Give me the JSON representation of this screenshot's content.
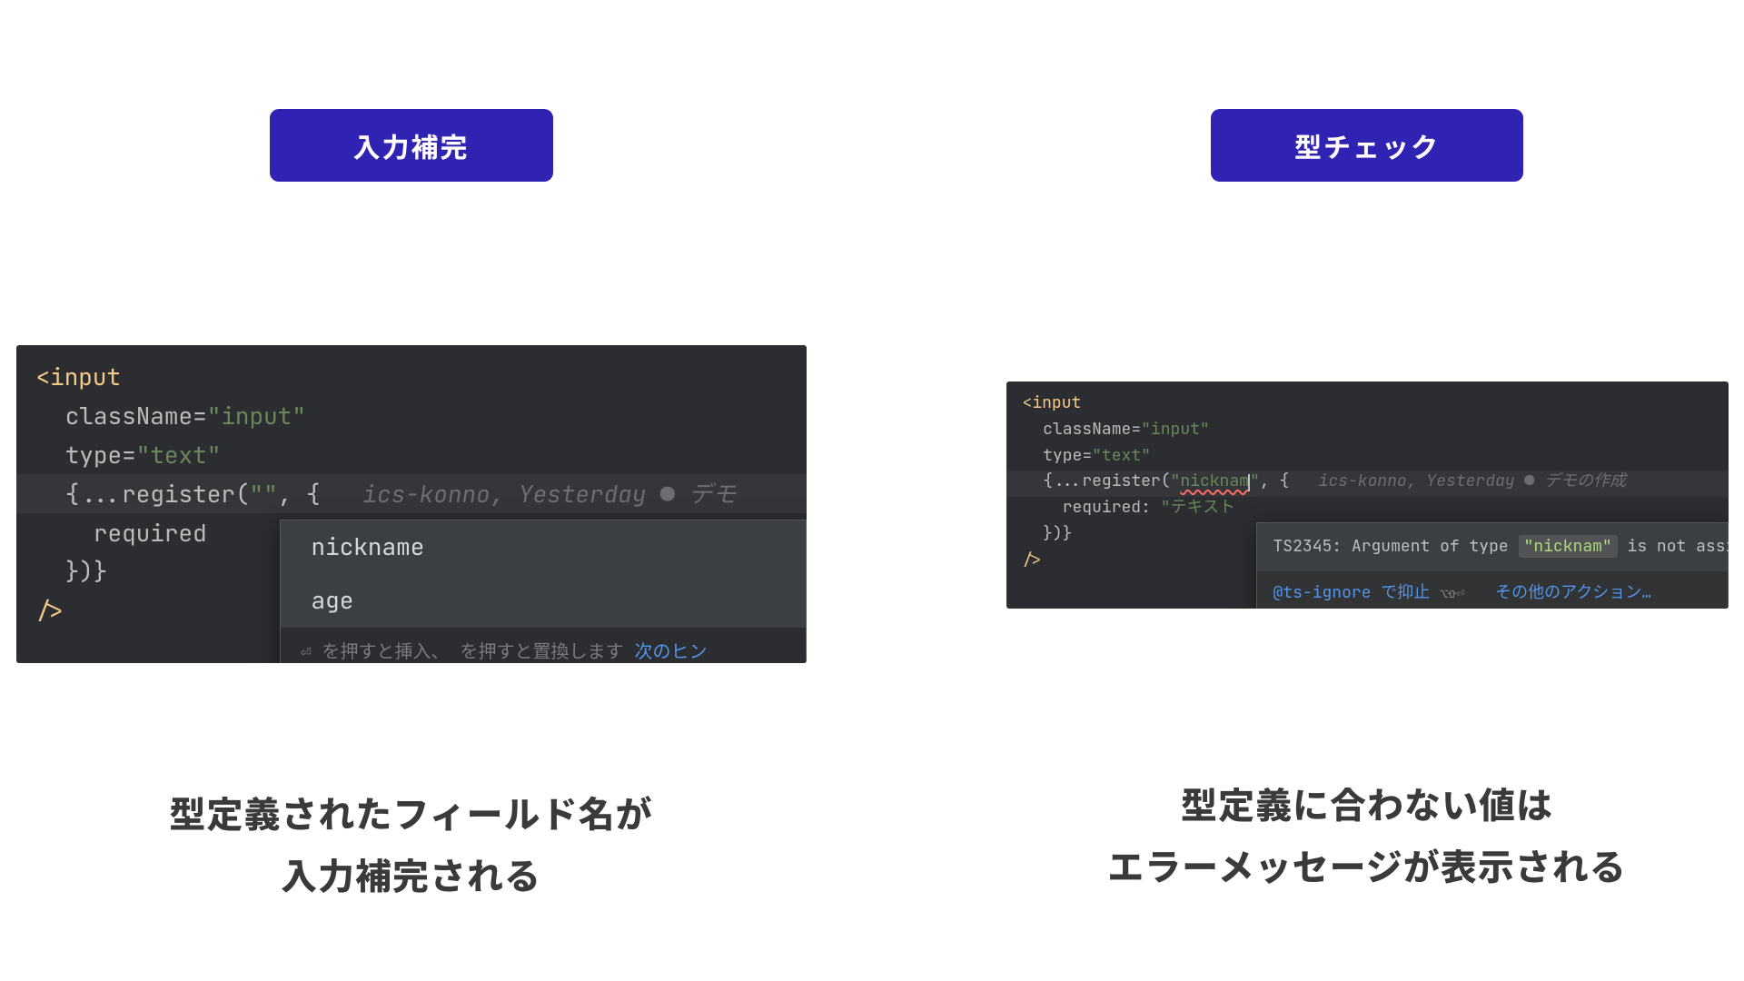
{
  "left": {
    "tag": "入力補完",
    "code": {
      "l1_open": "<",
      "l1_tag": "input",
      "l2_attr": "className",
      "l2_eq": "=",
      "l2_val": "\"input\"",
      "l3_attr": "type",
      "l3_eq": "=",
      "l3_val": "\"text\"",
      "l4_open": "{",
      "l4_dots": "...",
      "l4_fn": "register",
      "l4_paren": "(",
      "l4_arg": "\"\"",
      "l4_comma": ", {",
      "l4_blame_author": "ics-konno, Yesterday",
      "l4_blame_sep": " ● ",
      "l4_blame_msg": "デモ",
      "l5_key": "required",
      "l6_close": "})}",
      "l7_close": "/>"
    },
    "popup": {
      "item1": "nickname",
      "item2": "age",
      "hint_pre": "を押すと挿入、   を押すと置換します",
      "hint_link": "次のヒン"
    },
    "caption_l1": "型定義されたフィールド名が",
    "caption_l2": "入力補完される"
  },
  "right": {
    "tag": "型チェック",
    "code": {
      "l1_open": "<",
      "l1_tag": "input",
      "l2_attr": "className",
      "l2_eq": "=",
      "l2_val": "\"input\"",
      "l3_attr": "type",
      "l3_eq": "=",
      "l3_val": "\"text\"",
      "l4_open": "{",
      "l4_dots": "...",
      "l4_fn": "register",
      "l4_paren": "(",
      "l4_arg_open": "\"",
      "l4_arg_text": "nicknam",
      "l4_arg_close": "\"",
      "l4_comma": ", {",
      "l4_blame_author": "ics-konno, Yesterday",
      "l4_blame_sep": " ● ",
      "l4_blame_msg": "デモの作成",
      "l5_key": "required",
      "l5_colon": ": ",
      "l5_val": "\"テキスト",
      "l6_close": "})}",
      "l7_close": "/>"
    },
    "popup": {
      "err_code": "TS2345:",
      "err_mid": " Argument of type ",
      "err_chip": "\"nicknam\"",
      "err_tail": " is not assi",
      "act1": "@ts-ignore で抑止",
      "kbd1": "⌥⇧⏎",
      "act2": "その他のアクション…"
    },
    "caption_l1": "型定義に合わない値は",
    "caption_l2": "エラーメッセージが表示される"
  }
}
